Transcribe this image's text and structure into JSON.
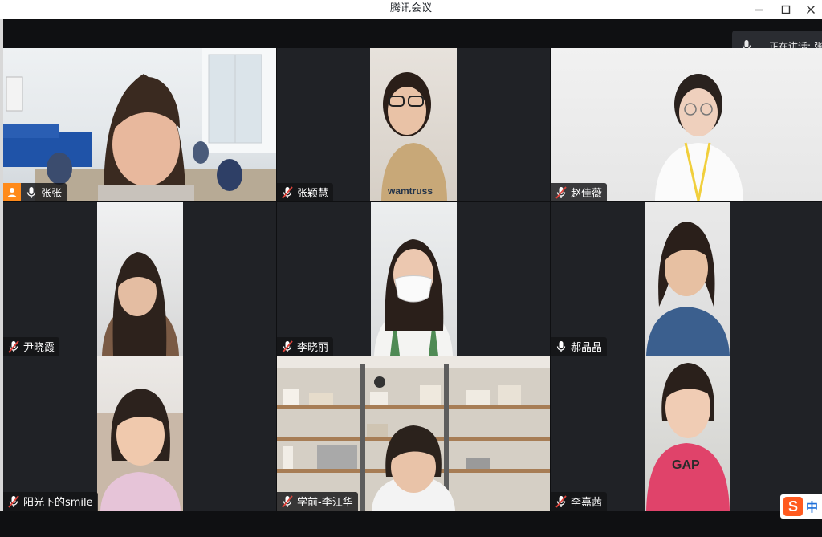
{
  "window": {
    "title": "腾讯会议",
    "minimize_icon": "minimize-icon",
    "maximize_icon": "maximize-icon",
    "close_icon": "close-icon"
  },
  "speaking_indicator": {
    "label": "正在讲话: 张",
    "icon": "microphone-icon"
  },
  "participants": [
    {
      "name": "张张",
      "mic": "on",
      "host": true,
      "active_speaker": true
    },
    {
      "name": "张颖慧",
      "mic": "muted"
    },
    {
      "name": "赵佳薇",
      "mic": "muted"
    },
    {
      "name": "尹晓霞",
      "mic": "muted"
    },
    {
      "name": "李晓丽",
      "mic": "muted"
    },
    {
      "name": "郝晶晶",
      "mic": "on"
    },
    {
      "name": "阳光下的smile",
      "mic": "muted"
    },
    {
      "name": "学前-李江华",
      "mic": "muted"
    },
    {
      "name": "李嘉茜",
      "mic": "muted"
    }
  ],
  "ime": {
    "logo": "S",
    "mode": "中"
  },
  "colors": {
    "active_border": "#26c56b",
    "host_badge": "#ff8a1a",
    "muted_mic": "#e0433b"
  }
}
